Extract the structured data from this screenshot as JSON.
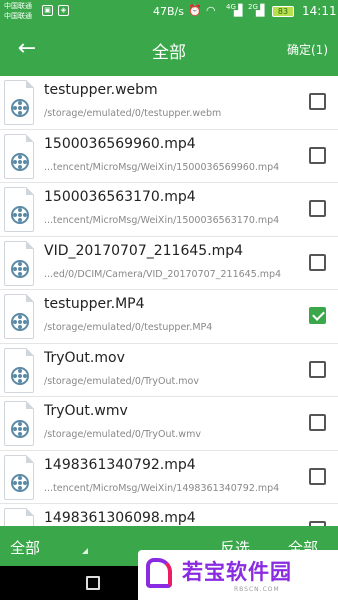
{
  "status_bar": {
    "carrier_1": "中国联通",
    "carrier_2": "中国联通",
    "network_speed": "47B/s",
    "battery_level": "83",
    "time": "14:11",
    "signal_labels": [
      "4G",
      "2G"
    ]
  },
  "header": {
    "title": "全部",
    "confirm_label": "确定(1)"
  },
  "files": [
    {
      "name": "testupper.webm",
      "path": "/storage/emulated/0/testupper.webm",
      "checked": false
    },
    {
      "name": "1500036569960.mp4",
      "path": "...tencent/MicroMsg/WeiXin/1500036569960.mp4",
      "checked": false
    },
    {
      "name": "1500036563170.mp4",
      "path": "...tencent/MicroMsg/WeiXin/1500036563170.mp4",
      "checked": false
    },
    {
      "name": "VID_20170707_211645.mp4",
      "path": "...ed/0/DCIM/Camera/VID_20170707_211645.mp4",
      "checked": false
    },
    {
      "name": "testupper.MP4",
      "path": "/storage/emulated/0/testupper.MP4",
      "checked": true
    },
    {
      "name": "TryOut.mov",
      "path": "/storage/emulated/0/TryOut.mov",
      "checked": false
    },
    {
      "name": "TryOut.wmv",
      "path": "/storage/emulated/0/TryOut.wmv",
      "checked": false
    },
    {
      "name": "1498361340792.mp4",
      "path": "...tencent/MicroMsg/WeiXin/1498361340792.mp4",
      "checked": false
    },
    {
      "name": "1498361306098.mp4",
      "path": "",
      "checked": false
    }
  ],
  "bottom_bar": {
    "filter_label": "全部",
    "invert_label": "反选",
    "select_all_label": "全部"
  },
  "watermark": {
    "brand": "若宝软件园",
    "site": "RBSCN.COM"
  },
  "colors": {
    "accent": "#3aa84a",
    "checked": "#3aa84a"
  }
}
